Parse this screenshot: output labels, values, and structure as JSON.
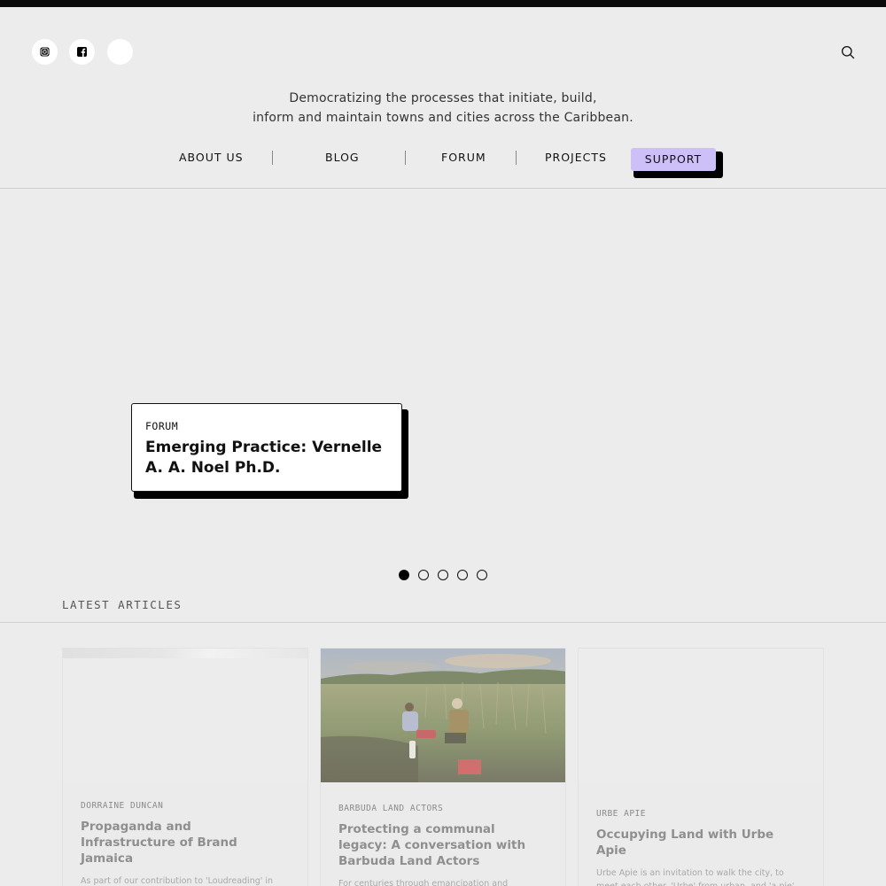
{
  "social": {
    "instagram": "instagram-icon",
    "facebook": "facebook-icon"
  },
  "header": {
    "tagline_line1": "Democratizing the processes that initiate, build,",
    "tagline_line2": "inform and maintain towns and cities across the Caribbean."
  },
  "nav": {
    "about": "ABOUT US",
    "blog": "BLOG",
    "forum": "FORUM",
    "projects": "PROJECTS",
    "support": "SUPPORT"
  },
  "hero": {
    "tag": "FORUM",
    "title": "Emerging Practice: Vernelle A. A. Noel Ph.D.",
    "slides_total": 5,
    "active_slide": 1
  },
  "latest": {
    "heading": "LATEST ARTICLES",
    "articles": [
      {
        "author": "DORRAINE DUNCAN",
        "title": "Propaganda and Infrastructure of Brand Jamaica",
        "excerpt": "As part of our contribution to 'Loudreading' in collaboration with e-flux Architecture, we traced a"
      },
      {
        "author": "BARBUDA LAND ACTORS",
        "title": "Protecting a communal legacy: A conversation with Barbuda Land Actors",
        "excerpt": "For centuries through emancipation and"
      },
      {
        "author": "URBE APIE",
        "title": "Occupying Land with Urbe Apie",
        "excerpt": "Urbe Apie is an invitation to walk the city, to meet each other. 'Urbe' from urban, and 'a pie' means on foot, together it means let's walk, meet each other…"
      }
    ]
  },
  "colors": {
    "background": "#ececec",
    "support_accent": "#cdbff7",
    "topbar": "#0b0b0b"
  }
}
